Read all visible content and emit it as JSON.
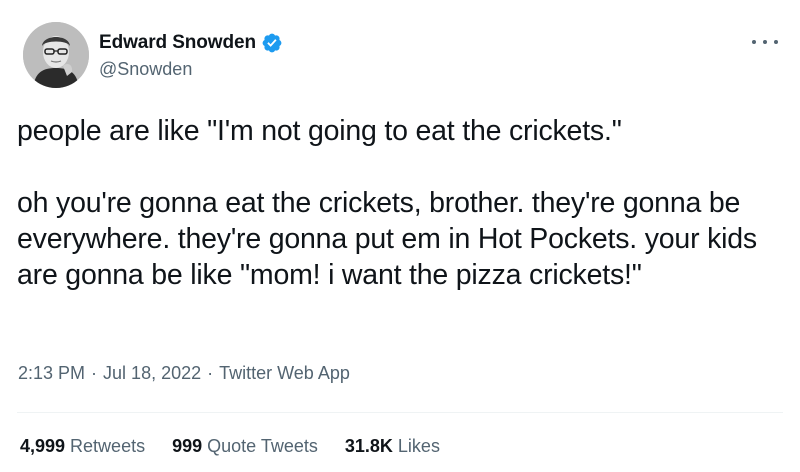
{
  "author": {
    "display_name": "Edward Snowden",
    "handle": "@Snowden",
    "verified": true,
    "verified_color": "#1d9bf0"
  },
  "tweet": {
    "paragraphs": [
      "people are like \"I'm not going to eat the crickets.\"",
      "oh you're gonna eat the crickets, brother. they're gonna be everywhere. they're gonna put em in Hot Pockets. your kids are gonna be like \"mom! i want the pizza crickets!\""
    ],
    "time": "2:13 PM",
    "date": "Jul 18, 2022",
    "source": "Twitter Web App",
    "separator": "·"
  },
  "stats": {
    "retweets_count": "4,999",
    "retweets_label": "Retweets",
    "quotes_count": "999",
    "quotes_label": "Quote Tweets",
    "likes_count": "31.8K",
    "likes_label": "Likes"
  },
  "icons": {
    "verified": "verified-badge-icon",
    "more": "more-options-icon"
  },
  "colors": {
    "text": "#0f1419",
    "secondary": "#536471",
    "divider": "#eff3f4"
  }
}
